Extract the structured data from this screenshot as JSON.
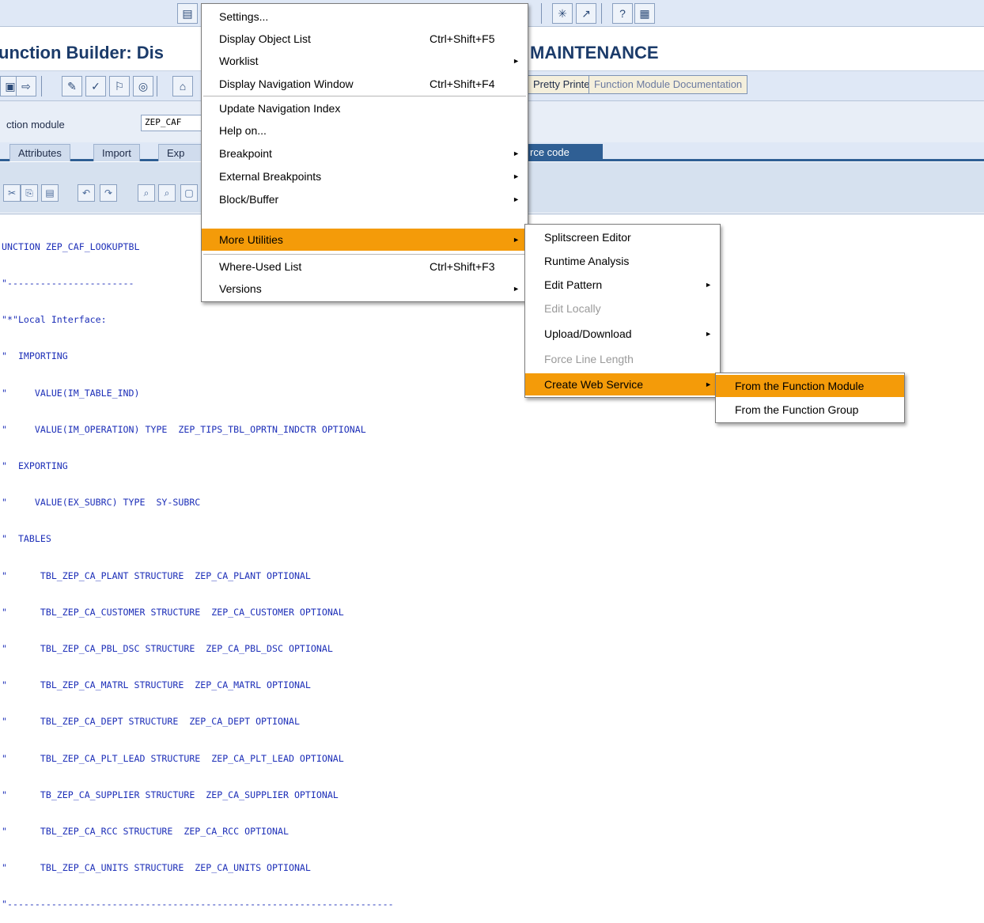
{
  "window": {
    "title_left": "unction Builder: Dis",
    "title_right": "MAINTENANCE"
  },
  "toolbar": {
    "pretty_printer": "Pretty Printer",
    "function_module_documentation": "Function Module Documentation"
  },
  "header": {
    "function_module_label": "ction module",
    "function_module_value": "ZEP_CAF"
  },
  "tabs": [
    {
      "label": "Attributes"
    },
    {
      "label": "Import"
    },
    {
      "label": "Exp"
    },
    {
      "label": "rce code"
    }
  ],
  "editor": {
    "lines": [
      "UNCTION ZEP_CAF_LOOKUPTBL",
      "\"-----------------------",
      "\"*\"Local Interface:",
      "\"  IMPORTING",
      "\"     VALUE(IM_TABLE_IND)",
      "\"     VALUE(IM_OPERATION) TYPE  ZEP_TIPS_TBL_OPRTN_INDCTR OPTIONAL",
      "\"  EXPORTING",
      "\"     VALUE(EX_SUBRC) TYPE  SY-SUBRC",
      "\"  TABLES",
      "\"      TBL_ZEP_CA_PLANT STRUCTURE  ZEP_CA_PLANT OPTIONAL",
      "\"      TBL_ZEP_CA_CUSTOMER STRUCTURE  ZEP_CA_CUSTOMER OPTIONAL",
      "\"      TBL_ZEP_CA_PBL_DSC STRUCTURE  ZEP_CA_PBL_DSC OPTIONAL",
      "\"      TBL_ZEP_CA_MATRL STRUCTURE  ZEP_CA_MATRL OPTIONAL",
      "\"      TBL_ZEP_CA_DEPT STRUCTURE  ZEP_CA_DEPT OPTIONAL",
      "\"      TBL_ZEP_CA_PLT_LEAD STRUCTURE  ZEP_CA_PLT_LEAD OPTIONAL",
      "\"      TB_ZEP_CA_SUPPLIER STRUCTURE  ZEP_CA_SUPPLIER OPTIONAL",
      "\"      TBL_ZEP_CA_RCC STRUCTURE  ZEP_CA_RCC OPTIONAL",
      "\"      TBL_ZEP_CA_UNITS STRUCTURE  ZEP_CA_UNITS OPTIONAL",
      "\"----------------------------------------------------------------------"
    ]
  },
  "main_menu": {
    "items": [
      {
        "label": "Settings...",
        "accel": "",
        "submenu": false
      },
      {
        "label": "Display Object List",
        "accel": "Ctrl+Shift+F5",
        "submenu": false
      },
      {
        "label": "Worklist",
        "accel": "",
        "submenu": true
      },
      {
        "label": "Display Navigation Window",
        "accel": "Ctrl+Shift+F4",
        "submenu": false
      },
      {
        "label": "Update Navigation Index",
        "accel": "",
        "submenu": false
      },
      {
        "label": "Help on...",
        "accel": "",
        "submenu": false
      },
      {
        "label": "Breakpoint",
        "accel": "",
        "submenu": true
      },
      {
        "label": "External Breakpoints",
        "accel": "",
        "submenu": true
      },
      {
        "label": "Block/Buffer",
        "accel": "",
        "submenu": true
      },
      {
        "label": "More Utilities",
        "accel": "",
        "submenu": true
      },
      {
        "label": "Where-Used List",
        "accel": "Ctrl+Shift+F3",
        "submenu": false
      },
      {
        "label": "Versions",
        "accel": "",
        "submenu": true
      }
    ]
  },
  "more_utilities_menu": {
    "items": [
      {
        "label": "Splitscreen Editor",
        "submenu": false
      },
      {
        "label": "Runtime Analysis",
        "submenu": false
      },
      {
        "label": "Edit Pattern",
        "submenu": true
      },
      {
        "label": "Edit Locally",
        "submenu": false
      },
      {
        "label": "Upload/Download",
        "submenu": true
      },
      {
        "label": "Force Line Length",
        "submenu": false
      },
      {
        "label": "Create Web Service",
        "submenu": true
      }
    ]
  },
  "web_service_menu": {
    "items": [
      {
        "label": "From the Function Module"
      },
      {
        "label": "From the Function Group"
      }
    ]
  },
  "colors": {
    "highlight": "#f49b09",
    "title": "#1b3b6a",
    "code": "#1d2fb8"
  }
}
